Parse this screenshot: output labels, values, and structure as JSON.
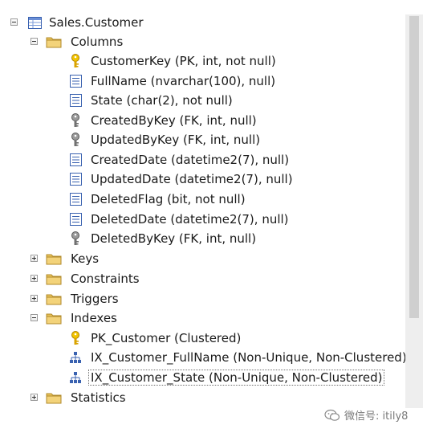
{
  "tree": {
    "table": {
      "label": "Sales.Customer",
      "icon": "table-icon"
    },
    "columns": {
      "label": "Columns",
      "items": [
        {
          "label": "CustomerKey (PK, int, not null)",
          "icon": "primary-key-icon"
        },
        {
          "label": "FullName (nvarchar(100), null)",
          "icon": "column-icon"
        },
        {
          "label": "State (char(2), not null)",
          "icon": "column-icon"
        },
        {
          "label": "CreatedByKey (FK, int, null)",
          "icon": "foreign-key-icon"
        },
        {
          "label": "UpdatedByKey (FK, int, null)",
          "icon": "foreign-key-icon"
        },
        {
          "label": "CreatedDate (datetime2(7), null)",
          "icon": "column-icon"
        },
        {
          "label": "UpdatedDate (datetime2(7), null)",
          "icon": "column-icon"
        },
        {
          "label": "DeletedFlag (bit, not null)",
          "icon": "column-icon"
        },
        {
          "label": "DeletedDate (datetime2(7), null)",
          "icon": "column-icon"
        },
        {
          "label": "DeletedByKey (FK, int, null)",
          "icon": "foreign-key-icon"
        }
      ]
    },
    "keys": {
      "label": "Keys"
    },
    "constraints": {
      "label": "Constraints"
    },
    "triggers": {
      "label": "Triggers"
    },
    "indexes": {
      "label": "Indexes",
      "items": [
        {
          "label": "PK_Customer (Clustered)",
          "icon": "primary-key-icon"
        },
        {
          "label": "IX_Customer_FullName (Non-Unique, Non-Clustered)",
          "icon": "index-icon"
        },
        {
          "label": "IX_Customer_State (Non-Unique, Non-Clustered)",
          "icon": "index-icon",
          "selected": true
        }
      ]
    },
    "statistics": {
      "label": "Statistics"
    }
  },
  "watermark": {
    "text": "微信号: itily8"
  },
  "colors": {
    "folder": "#e9c35a",
    "key_gold": "#d9a300",
    "key_gray": "#707070",
    "column_blue": "#3a62b0",
    "scrollbar": "#cfcfcf"
  }
}
